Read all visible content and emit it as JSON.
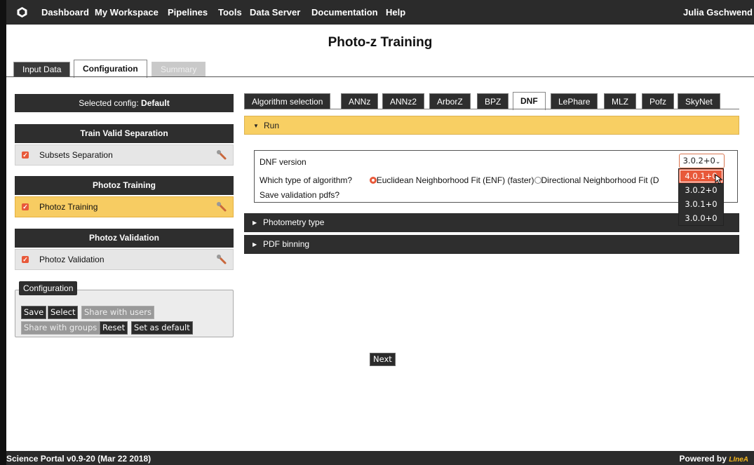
{
  "topnav": {
    "items": [
      "Dashboard",
      "My Workspace",
      "Pipelines",
      "Tools",
      "Data Server",
      "Documentation",
      "Help"
    ],
    "user": "Julia Gschwend"
  },
  "page_title": "Photo-z Training",
  "main_tabs": [
    {
      "label": "Input Data",
      "state": "normal"
    },
    {
      "label": "Configuration",
      "state": "active"
    },
    {
      "label": "Summary",
      "state": "disabled"
    }
  ],
  "sidebar": {
    "selected_config_label": "Selected config: ",
    "selected_config_value": "Default",
    "groups": [
      {
        "title": "Train Valid Separation",
        "item": "Subsets Separation",
        "active": false
      },
      {
        "title": "Photoz Training",
        "item": "Photoz Training",
        "active": true
      },
      {
        "title": "Photoz Validation",
        "item": "Photoz Validation",
        "active": false
      }
    ],
    "configuration": {
      "legend": "Configuration",
      "buttons": [
        "Save",
        "Select",
        "Share with users",
        "Share with groups",
        "Reset",
        "Set as default"
      ]
    }
  },
  "algorithm_tabs": [
    "Algorithm selection",
    "ANNz",
    "ANNz2",
    "ArborZ",
    "BPZ",
    "DNF",
    "LePhare",
    "MLZ",
    "Pofz",
    "SkyNet"
  ],
  "algorithm_active": "DNF",
  "accordion": {
    "run": "Run",
    "photometry": "Photometry type",
    "pdf": "PDF binning"
  },
  "run_panel": {
    "version_label": "DNF version",
    "algorithm_label": "Which type of algorithm?",
    "option_enf": "Euclidean Neighborhood Fit (ENF) (faster)",
    "option_dnf": "Directional Neighborhood Fit (D",
    "save_label": "Save validation pdfs?"
  },
  "version_select": {
    "value": "3.0.2+0",
    "options": [
      "4.0.1+0",
      "3.0.2+0",
      "3.0.1+0",
      "3.0.0+0"
    ],
    "highlighted": "4.0.1+0"
  },
  "next_label": "Next",
  "footer": {
    "version": "Science Portal v0.9-20 (Mar 22 2018)",
    "powered": "Powered by",
    "brand": "LIneA"
  },
  "colors": {
    "accent": "#e8593a",
    "highlight": "#f8cf63",
    "dark": "#2e2e2e"
  }
}
